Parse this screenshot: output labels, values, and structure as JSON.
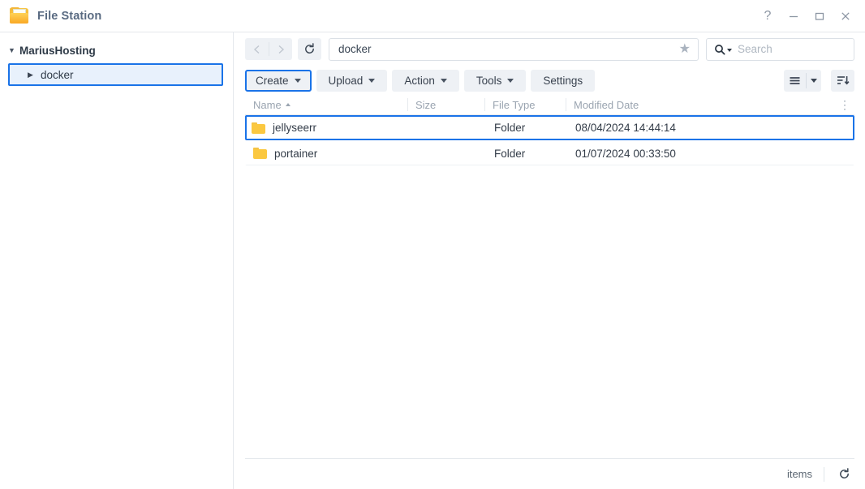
{
  "window": {
    "title": "File Station",
    "app_icon": "folder-icon",
    "controls": {
      "help": "?",
      "minimize": "minimize-icon",
      "maximize": "maximize-icon",
      "close": "close-icon"
    }
  },
  "sidebar": {
    "root": {
      "label": "MariusHosting",
      "caret": "▼",
      "expanded": true
    },
    "children": [
      {
        "label": "docker",
        "caret": "▶",
        "selected": true
      }
    ]
  },
  "navbar": {
    "back": "back-icon",
    "forward": "forward-icon",
    "refresh": "refresh-icon",
    "path_value": "docker",
    "favorite_icon": "★",
    "search_placeholder": "Search"
  },
  "toolbar": {
    "buttons": [
      {
        "label": "Create",
        "has_dropdown": true,
        "focused": true
      },
      {
        "label": "Upload",
        "has_dropdown": true,
        "focused": false
      },
      {
        "label": "Action",
        "has_dropdown": true,
        "focused": false
      },
      {
        "label": "Tools",
        "has_dropdown": true,
        "focused": false
      },
      {
        "label": "Settings",
        "has_dropdown": false,
        "focused": false
      }
    ],
    "view_button": "list-view-icon",
    "view_dropdown": "chevron-down-icon",
    "sort_button": "sort-descending-icon"
  },
  "filelist": {
    "columns": [
      {
        "key": "name",
        "label": "Name",
        "sorted": true,
        "sort_dir": "asc"
      },
      {
        "key": "size",
        "label": "Size",
        "sorted": false
      },
      {
        "key": "type",
        "label": "File Type",
        "sorted": false
      },
      {
        "key": "date",
        "label": "Modified Date",
        "sorted": false
      }
    ],
    "column_menu_icon": "⋮",
    "rows": [
      {
        "name": "jellyseerr",
        "size": "",
        "type": "Folder",
        "date": "08/04/2024 14:44:14",
        "icon": "folder-icon",
        "selected": true
      },
      {
        "name": "portainer",
        "size": "",
        "type": "Folder",
        "date": "01/07/2024 00:33:50",
        "icon": "folder-icon",
        "selected": false
      }
    ]
  },
  "statusbar": {
    "items_label": "items",
    "refresh_icon": "refresh-icon"
  },
  "colors": {
    "accent": "#1a73e8",
    "selection_bg": "#e8f1fc",
    "folder_yellow": "#fbc840",
    "title_text": "#5a6b82",
    "muted_text": "#9aa4b0",
    "button_bg": "#eef1f5"
  }
}
